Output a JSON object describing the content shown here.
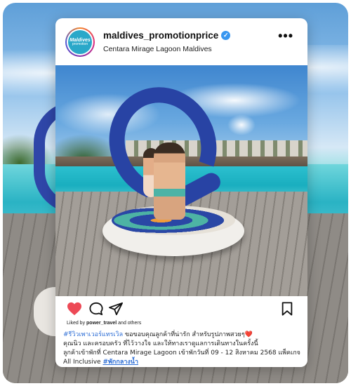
{
  "post": {
    "username": "maldives_promotionprice",
    "location": "Centara Mirage Lagoon Maldives",
    "avatar_line1": "Maldives",
    "avatar_line2": "promotion",
    "more_label": "•••",
    "liked_prefix": "Liked by ",
    "liked_user": "power_travel",
    "liked_suffix": " and others",
    "caption": {
      "hashtag1": "#รีวิวเพาเวอร์แทรเวิล",
      "line1_text": " ขอขอบคุณลูกค้าที่น่ารัก สำหรับรูปภาพสวยๆ",
      "heart_emoji": "❤️",
      "line2": "คุณนิว และครอบครัว ที่ไว้วางใจ และให้ทางเราดูแลการเดินทางในครั้งนี้",
      "line3": "ลูกค้าเข้าพักที่ Centara Mirage Lagoon เข้าพักวันที่ 09 - 12 สิงหาคม 2568 แพ็คเกจ",
      "line4_text": "All Inclusive ",
      "hashtag2": "#พักกลางน้ำ"
    }
  },
  "colors": {
    "heart": "#ed4956",
    "verified": "#3897f0",
    "hashtag": "#2f6fd6",
    "sculpture": "#2843a4"
  },
  "icons": [
    "heart-icon",
    "comment-icon",
    "share-icon",
    "bookmark-icon",
    "verified-badge-icon",
    "more-options-icon"
  ]
}
